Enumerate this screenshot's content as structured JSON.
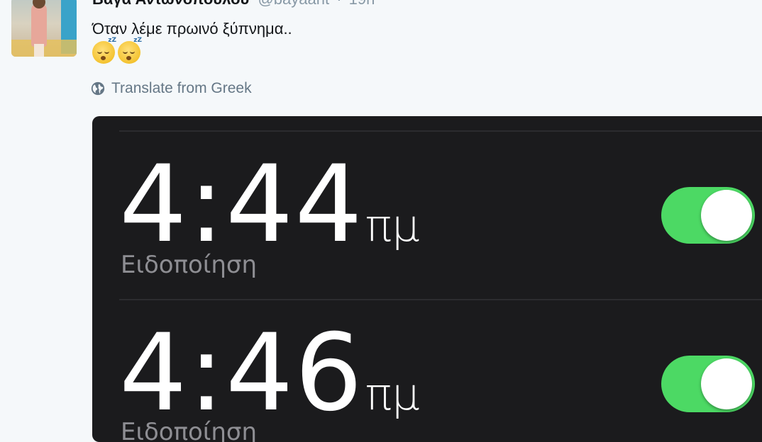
{
  "tweet": {
    "author_name": "Βάγα Αντωνοπούλου",
    "handle": "@bayaant",
    "separator": "·",
    "time": "19h",
    "text": "Όταν λέμε πρωινό ξύπνημα..",
    "emojis": [
      "sleeping-face",
      "sleeping-face"
    ],
    "translate_label": "Translate from Greek"
  },
  "alarms": [
    {
      "time": "4:44",
      "ampm": "πμ",
      "label": "Ειδοποίηση",
      "enabled": true
    },
    {
      "time": "4:46",
      "ampm": "πμ",
      "label": "Ειδοποίηση",
      "enabled": true
    }
  ],
  "colors": {
    "toggle_on": "#4cd964",
    "media_bg": "#1b1b1d",
    "page_bg": "#f5f8fa"
  }
}
